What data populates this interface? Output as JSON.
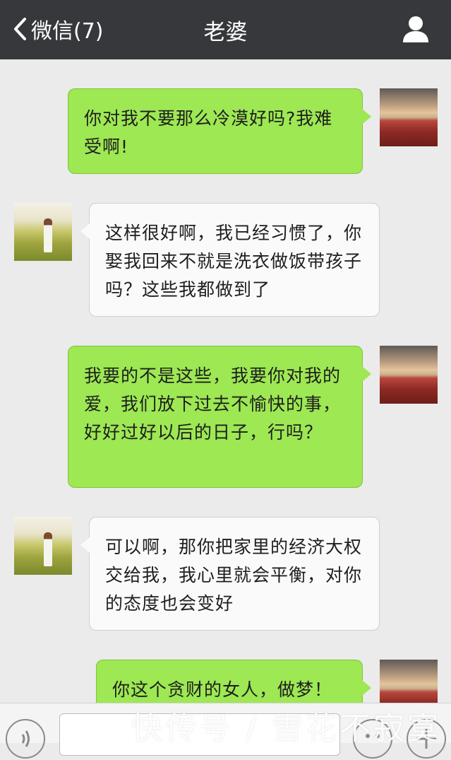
{
  "header": {
    "back_label": "微信(7)",
    "title": "老婆"
  },
  "messages": [
    {
      "sender": "me",
      "text": "你对我不要那么冷漠好吗?我难受啊!"
    },
    {
      "sender": "her",
      "text": "这样很好啊，我已经习惯了，你娶我回来不就是洗衣做饭带孩子吗？这些我都做到了"
    },
    {
      "sender": "me",
      "text": "我要的不是这些，我要你对我的爱，我们放下过去不愉快的事，好好过好以后的日子，行吗？"
    },
    {
      "sender": "her",
      "text": "可以啊，那你把家里的经济大权交给我，我心里就会平衡，对你的态度也会变好"
    },
    {
      "sender": "me",
      "text": "你这个贪财的女人，做梦！"
    }
  ],
  "watermark": "快传号 / 雪花不寂寞",
  "icons": {
    "back": "chevron-left-icon",
    "profile": "person-icon",
    "voice": "voice-icon",
    "emoji": "emoji-icon",
    "plus": "plus-icon"
  },
  "colors": {
    "topbar": "#37383c",
    "bubble_me": "#9de853",
    "bubble_her": "#fafafa",
    "background": "#ebebeb"
  }
}
